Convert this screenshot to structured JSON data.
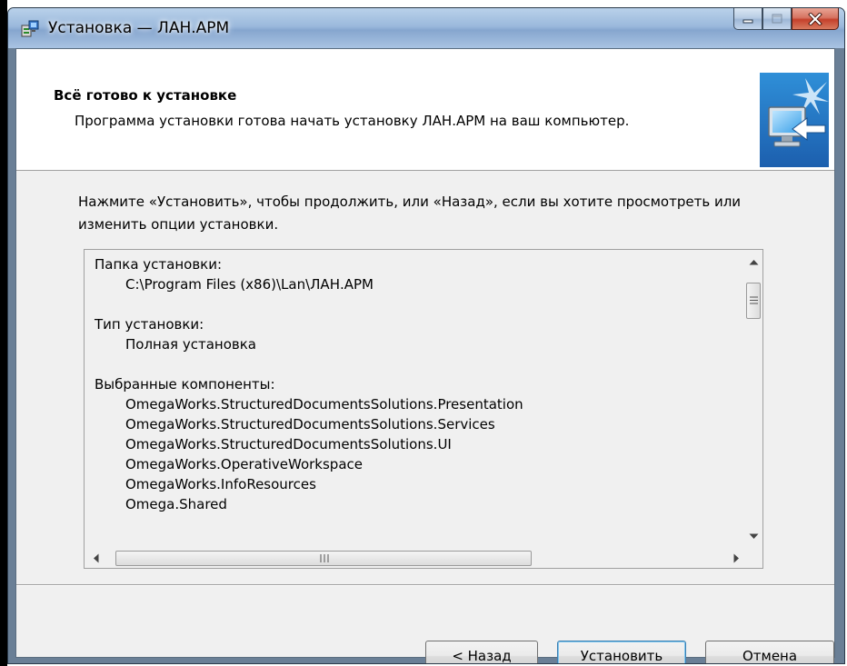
{
  "window": {
    "title": "Установка — ЛАН.АРМ"
  },
  "header": {
    "title": "Всё готово к установке",
    "subtitle": "Программа установки готова начать установку ЛАН.АРМ на ваш компьютер."
  },
  "instruction": "Нажмите «Установить», чтобы продолжить, или «Назад», если вы хотите просмотреть или изменить опции установки.",
  "memo": {
    "install_folder_label": "Папка установки:",
    "install_folder_value": "C:\\Program Files (x86)\\Lan\\ЛАН.АРМ",
    "install_type_label": "Тип установки:",
    "install_type_value": "Полная установка",
    "components_label": "Выбранные компоненты:",
    "components": [
      "OmegaWorks.StructuredDocumentsSolutions.Presentation",
      "OmegaWorks.StructuredDocumentsSolutions.Services",
      "OmegaWorks.StructuredDocumentsSolutions.UI",
      "OmegaWorks.OperativeWorkspace",
      "OmegaWorks.InfoResources",
      "Omega.Shared"
    ]
  },
  "buttons": {
    "back": "< Назад",
    "install": "Установить",
    "cancel": "Отмена"
  },
  "colors": {
    "titlebar": "#9bb9dc",
    "client_bg": "#f0f0f0",
    "default_button_border": "#3c7fb1",
    "close_button": "#c4402b"
  },
  "icons": {
    "title": "setup-icon",
    "header": "monitor-install-icon"
  }
}
